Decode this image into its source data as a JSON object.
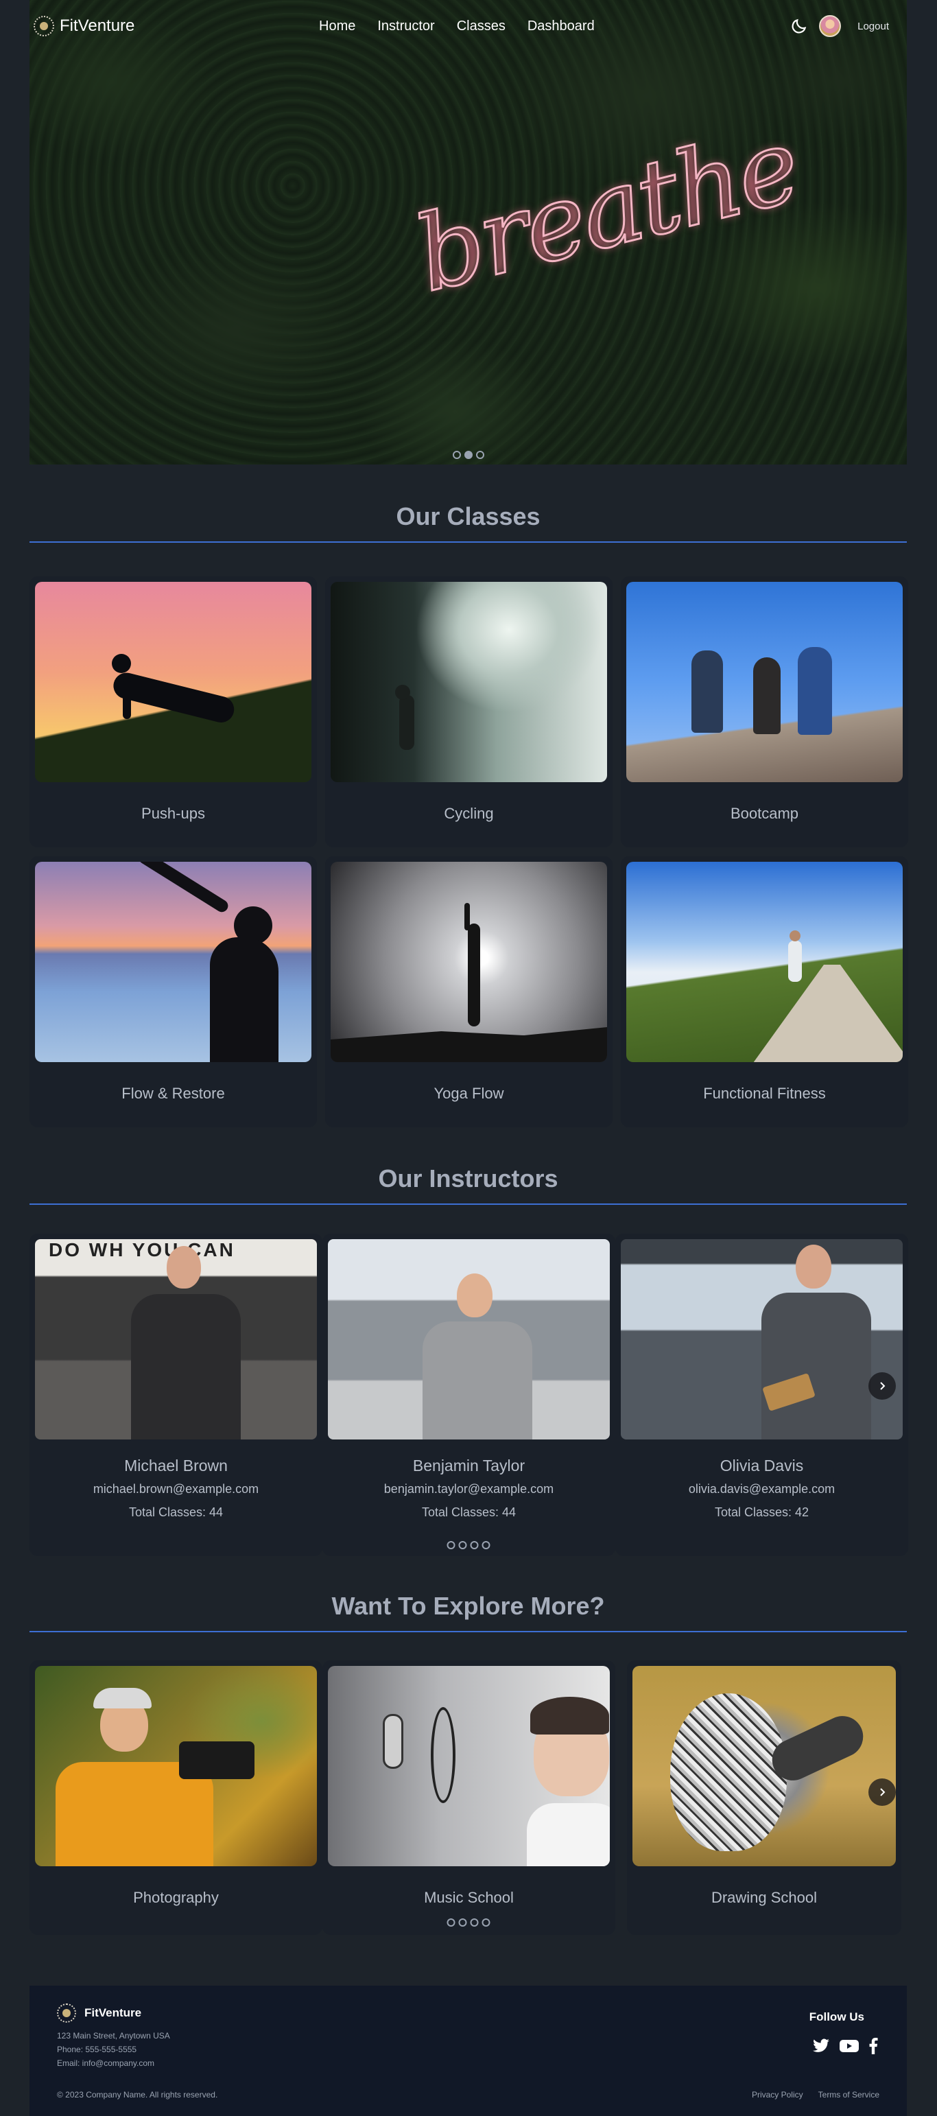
{
  "nav": {
    "brand": "FitVenture",
    "links": [
      "Home",
      "Instructor",
      "Classes",
      "Dashboard"
    ],
    "logout": "Logout"
  },
  "hero": {
    "sign_text": "breathe",
    "slides_total": 3,
    "active_slide": 1
  },
  "classes": {
    "title": "Our Classes",
    "items": [
      {
        "name": "Push-ups"
      },
      {
        "name": "Cycling"
      },
      {
        "name": "Bootcamp"
      },
      {
        "name": "Flow & Restore"
      },
      {
        "name": "Yoga Flow"
      },
      {
        "name": "Functional Fitness"
      }
    ]
  },
  "instructors": {
    "title": "Our Instructors",
    "items": [
      {
        "name": "Michael Brown",
        "email": "michael.brown@example.com",
        "classes": "Total Classes: 44"
      },
      {
        "name": "Benjamin Taylor",
        "email": "benjamin.taylor@example.com",
        "classes": "Total Classes: 44"
      },
      {
        "name": "Olivia Davis",
        "email": "olivia.davis@example.com",
        "classes": "Total Classes: 42"
      }
    ],
    "gym_sign": "DO WH    YOU CAN"
  },
  "explore": {
    "title": "Want To Explore More?",
    "items": [
      {
        "name": "Photography"
      },
      {
        "name": "Music School"
      },
      {
        "name": "Drawing School"
      }
    ]
  },
  "footer": {
    "brand": "FitVenture",
    "address": "123 Main Street, Anytown USA",
    "phone": "Phone: 555-555-5555",
    "email": "Email: info@company.com",
    "follow": "Follow Us",
    "copyright": "© 2023 Company Name. All rights reserved.",
    "privacy": "Privacy Policy",
    "terms": "Terms of Service"
  },
  "colors": {
    "page_bg": "#1d232a",
    "card_bg": "#1a2029",
    "accent_rule": "#3d6fd4",
    "footer_bg": "#111827",
    "neon": "#f4b6c4"
  },
  "icons": [
    "logo-icon",
    "moon-icon",
    "avatar",
    "chevron-right-icon",
    "twitter-icon",
    "youtube-icon",
    "facebook-icon"
  ]
}
